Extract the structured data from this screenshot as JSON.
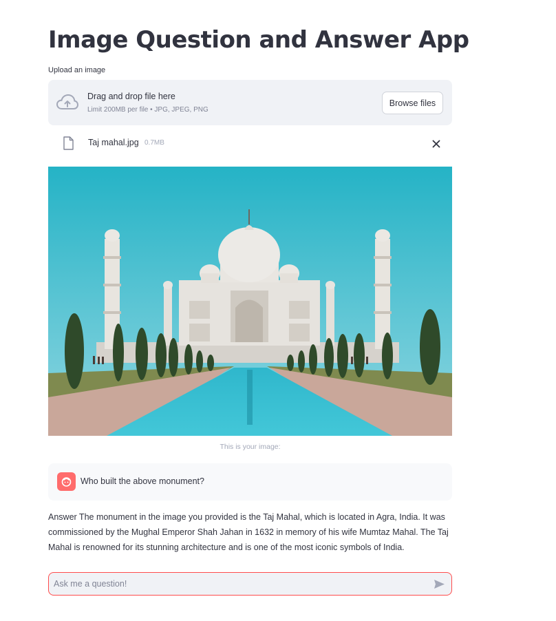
{
  "app": {
    "title": "Image Question and Answer App"
  },
  "uploader": {
    "label": "Upload an image",
    "drop_text": "Drag and drop file here",
    "limit_text": "Limit 200MB per file • JPG, JPEG, PNG",
    "browse_label": "Browse files",
    "icon": "cloud-upload-icon"
  },
  "uploaded_file": {
    "name": "Taj mahal.jpg",
    "size": "0.7MB",
    "icon": "file-icon",
    "remove_icon": "close-icon"
  },
  "image": {
    "caption": "This is your image:"
  },
  "chat": {
    "user_message": "Who built the above monument?",
    "answer": "Answer The monument in the image you provided is the Taj Mahal, which is located in Agra, India. It was commissioned by the Mughal Emperor Shah Jahan in 1632 in memory of his wife Mumtaz Mahal. The Taj Mahal is renowned for its stunning architecture and is one of the most iconic symbols of India.",
    "input_placeholder": "Ask me a question!",
    "send_icon": "send-icon"
  },
  "colors": {
    "accent": "#ff4b4b",
    "avatar": "#ff6c6c",
    "panel": "#f0f2f6",
    "text": "#31333f"
  }
}
